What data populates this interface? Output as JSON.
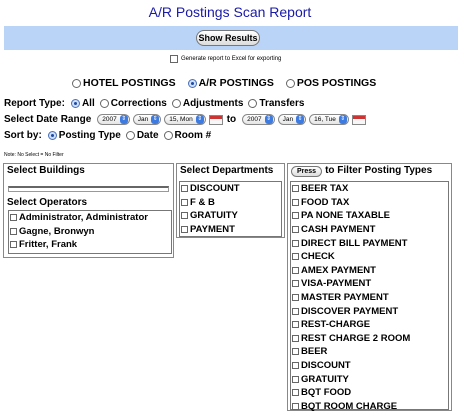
{
  "page": {
    "title": "A/R Postings Scan Report"
  },
  "toolbar": {
    "show_results_label": "Show Results",
    "excel_label": "Generate report to Excel for exporting"
  },
  "posting_types": [
    {
      "label": "HOTEL POSTINGS",
      "selected": false
    },
    {
      "label": "A/R POSTINGS",
      "selected": true
    },
    {
      "label": "POS POSTINGS",
      "selected": false
    }
  ],
  "report_type": {
    "label": "Report Type:",
    "options": [
      {
        "label": "All",
        "selected": true
      },
      {
        "label": "Corrections",
        "selected": false
      },
      {
        "label": "Adjustments",
        "selected": false
      },
      {
        "label": "Transfers",
        "selected": false
      }
    ]
  },
  "date_range": {
    "label": "Select Date Range",
    "from": {
      "year": "2007",
      "month": "Jan",
      "day": "15, Mon"
    },
    "to_label": "to",
    "to": {
      "year": "2007",
      "month": "Jan",
      "day": "16, Tue"
    }
  },
  "sort_by": {
    "label": "Sort by:",
    "options": [
      {
        "label": "Posting Type",
        "selected": true
      },
      {
        "label": "Date",
        "selected": false
      },
      {
        "label": "Room #",
        "selected": false
      }
    ]
  },
  "note": "Note: No Select = No Filter",
  "buildings": {
    "header": "Select Buildings"
  },
  "operators": {
    "header": "Select Operators",
    "items": [
      "Administrator, Administrator",
      "Gagne, Bronwyn",
      "Fritter, Frank"
    ]
  },
  "departments": {
    "header": "Select Departments",
    "items": [
      "DISCOUNT",
      "F & B",
      "GRATUITY",
      "PAYMENT"
    ]
  },
  "posting_filter": {
    "press_label": "Press",
    "header": "to Filter Posting Types",
    "items": [
      "BEER TAX",
      "FOOD TAX",
      "PA NONE TAXABLE",
      "CASH PAYMENT",
      "DIRECT BILL PAYMENT",
      "CHECK",
      "AMEX PAYMENT",
      "VISA-PAYMENT",
      "MASTER PAYMENT",
      "DISCOVER PAYMENT",
      "REST-CHARGE",
      "REST CHARGE 2 ROOM",
      "BEER",
      "DISCOUNT",
      "GRATUITY",
      "BQT FOOD",
      "BQT ROOM CHARGE"
    ]
  },
  "colors": {
    "title": "#1a1aa8",
    "bar": "#b9d4f7"
  }
}
